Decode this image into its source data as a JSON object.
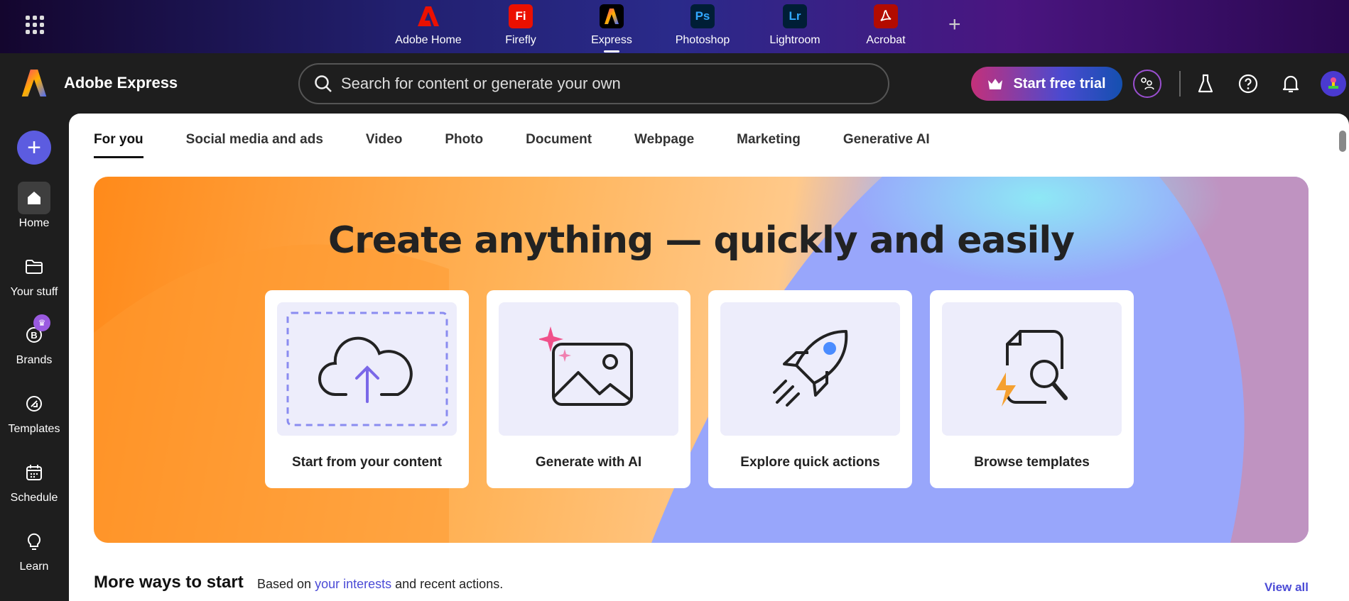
{
  "app_switcher": {
    "apps": [
      {
        "label": "Adobe Home",
        "icon": "adobe-home-icon",
        "glyph": "A",
        "color": "#eb1000"
      },
      {
        "label": "Firefly",
        "icon": "firefly-icon",
        "glyph": "Fi",
        "color": "#eb1000"
      },
      {
        "label": "Express",
        "icon": "express-icon",
        "glyph": "A",
        "color": "#000000"
      },
      {
        "label": "Photoshop",
        "icon": "photoshop-icon",
        "glyph": "Ps",
        "color": "#001e36"
      },
      {
        "label": "Lightroom",
        "icon": "lightroom-icon",
        "glyph": "Lr",
        "color": "#001e36"
      },
      {
        "label": "Acrobat",
        "icon": "acrobat-icon",
        "glyph": "A",
        "color": "#b30b00"
      }
    ],
    "active": "Express"
  },
  "header": {
    "brand": "Adobe Express",
    "search_placeholder": "Search for content or generate your own",
    "trial_label": "Start free trial"
  },
  "sidebar": {
    "items": [
      {
        "label": "Home"
      },
      {
        "label": "Your stuff"
      },
      {
        "label": "Brands"
      },
      {
        "label": "Templates"
      },
      {
        "label": "Schedule"
      },
      {
        "label": "Learn"
      }
    ]
  },
  "tabs": [
    "For you",
    "Social media and ads",
    "Video",
    "Photo",
    "Document",
    "Webpage",
    "Marketing",
    "Generative AI"
  ],
  "hero": {
    "title": "Create anything — quickly and easily",
    "cards": [
      {
        "label": "Start from your content"
      },
      {
        "label": "Generate with AI"
      },
      {
        "label": "Explore quick actions"
      },
      {
        "label": "Browse templates"
      }
    ]
  },
  "more": {
    "title": "More ways to start",
    "sub_prefix": "Based on ",
    "sub_link": "your interests",
    "sub_suffix": " and recent actions.",
    "view_all": "View all"
  }
}
